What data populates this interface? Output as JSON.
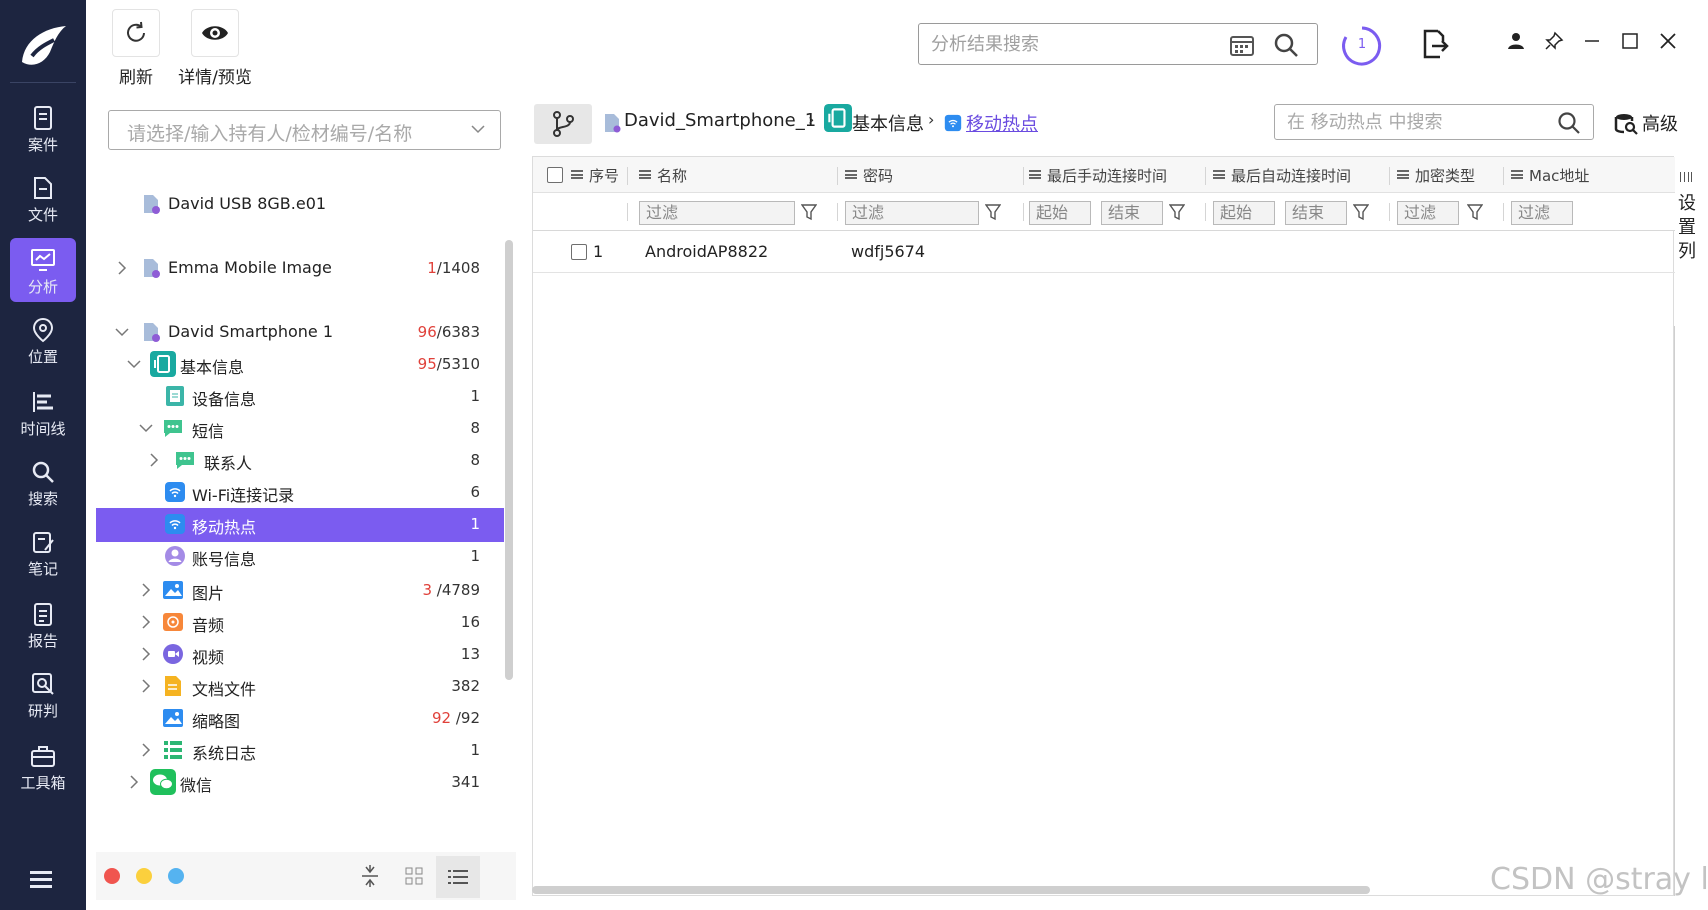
{
  "nav": {
    "items": [
      {
        "label": "案件",
        "icon": "case-icon"
      },
      {
        "label": "文件",
        "icon": "file-icon"
      },
      {
        "label": "分析",
        "icon": "analysis-icon",
        "active": true
      },
      {
        "label": "位置",
        "icon": "location-icon"
      },
      {
        "label": "时间线",
        "icon": "timeline-icon"
      },
      {
        "label": "搜索",
        "icon": "search-icon"
      },
      {
        "label": "笔记",
        "icon": "note-icon"
      },
      {
        "label": "报告",
        "icon": "report-icon"
      },
      {
        "label": "研判",
        "icon": "judge-icon"
      },
      {
        "label": "工具箱",
        "icon": "toolbox-icon"
      }
    ],
    "accent": "#7b5cf0",
    "background": "#1d2540"
  },
  "toolbar": {
    "refresh_label": "刷新",
    "detail_label": "详情/预览",
    "search_placeholder": "分析结果搜索",
    "task_count": "1"
  },
  "tree": {
    "select_placeholder": "请选择/输入持有人/检材编号/名称",
    "rows": [
      {
        "label": "David USB 8GB.e01",
        "count": "",
        "red": ""
      },
      {
        "label": "Emma Mobile Image",
        "red": "1",
        "count": "/1408"
      },
      {
        "label": "David Smartphone 1",
        "red": "96",
        "count": "/6383"
      },
      {
        "label": "基本信息",
        "red": "95",
        "count": "/5310"
      },
      {
        "label": "设备信息",
        "red": "",
        "count": "1"
      },
      {
        "label": "短信",
        "red": "",
        "count": "8"
      },
      {
        "label": "联系人",
        "red": "",
        "count": "8"
      },
      {
        "label": "Wi-Fi连接记录",
        "red": "",
        "count": "6"
      },
      {
        "label": "移动热点",
        "red": "",
        "count": "1"
      },
      {
        "label": "账号信息",
        "red": "",
        "count": "1"
      },
      {
        "label": "图片",
        "red": "3",
        "count": " /4789"
      },
      {
        "label": "音频",
        "red": "",
        "count": "16"
      },
      {
        "label": "视频",
        "red": "",
        "count": "13"
      },
      {
        "label": "文档文件",
        "red": "",
        "count": "382"
      },
      {
        "label": "缩略图",
        "red": "92",
        "count": " /92"
      },
      {
        "label": "系统日志",
        "red": "",
        "count": "1"
      },
      {
        "label": "微信",
        "red": "",
        "count": "341"
      }
    ]
  },
  "breadcrumb": {
    "device": "David_Smartphone_1",
    "category": "基本信息",
    "current": "移动热点"
  },
  "grid": {
    "search_placeholder": "在 移动热点 中搜索",
    "advanced_label": "高级",
    "set_columns_label": "设置列",
    "columns": [
      "序号",
      "名称",
      "密码",
      "最后手动连接时间",
      "最后自动连接时间",
      "加密类型",
      "Mac地址"
    ],
    "filter_placeholder": "过滤",
    "date_start": "起始",
    "date_end": "结束",
    "rows": [
      {
        "index": "1",
        "name": "AndroidAP8822",
        "password": "wdfj5674"
      }
    ]
  },
  "watermark": "CSDN @stray l"
}
